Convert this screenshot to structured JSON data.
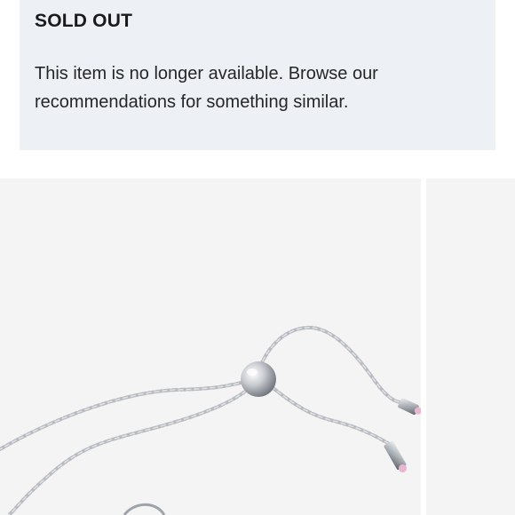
{
  "notice": {
    "title": "SOLD OUT",
    "message": "This item is no longer available. Browse our recommendations for something similar."
  },
  "gallery": {
    "main_image_icon": "bracelet-product-image",
    "next_image_icon": "next-product-image-peek"
  },
  "colors": {
    "notice_background": "#edf1f5",
    "image_background": "#f4f4f4",
    "chain_silver": "#b9bcc1",
    "crystal_pink": "#e8b6cf"
  }
}
